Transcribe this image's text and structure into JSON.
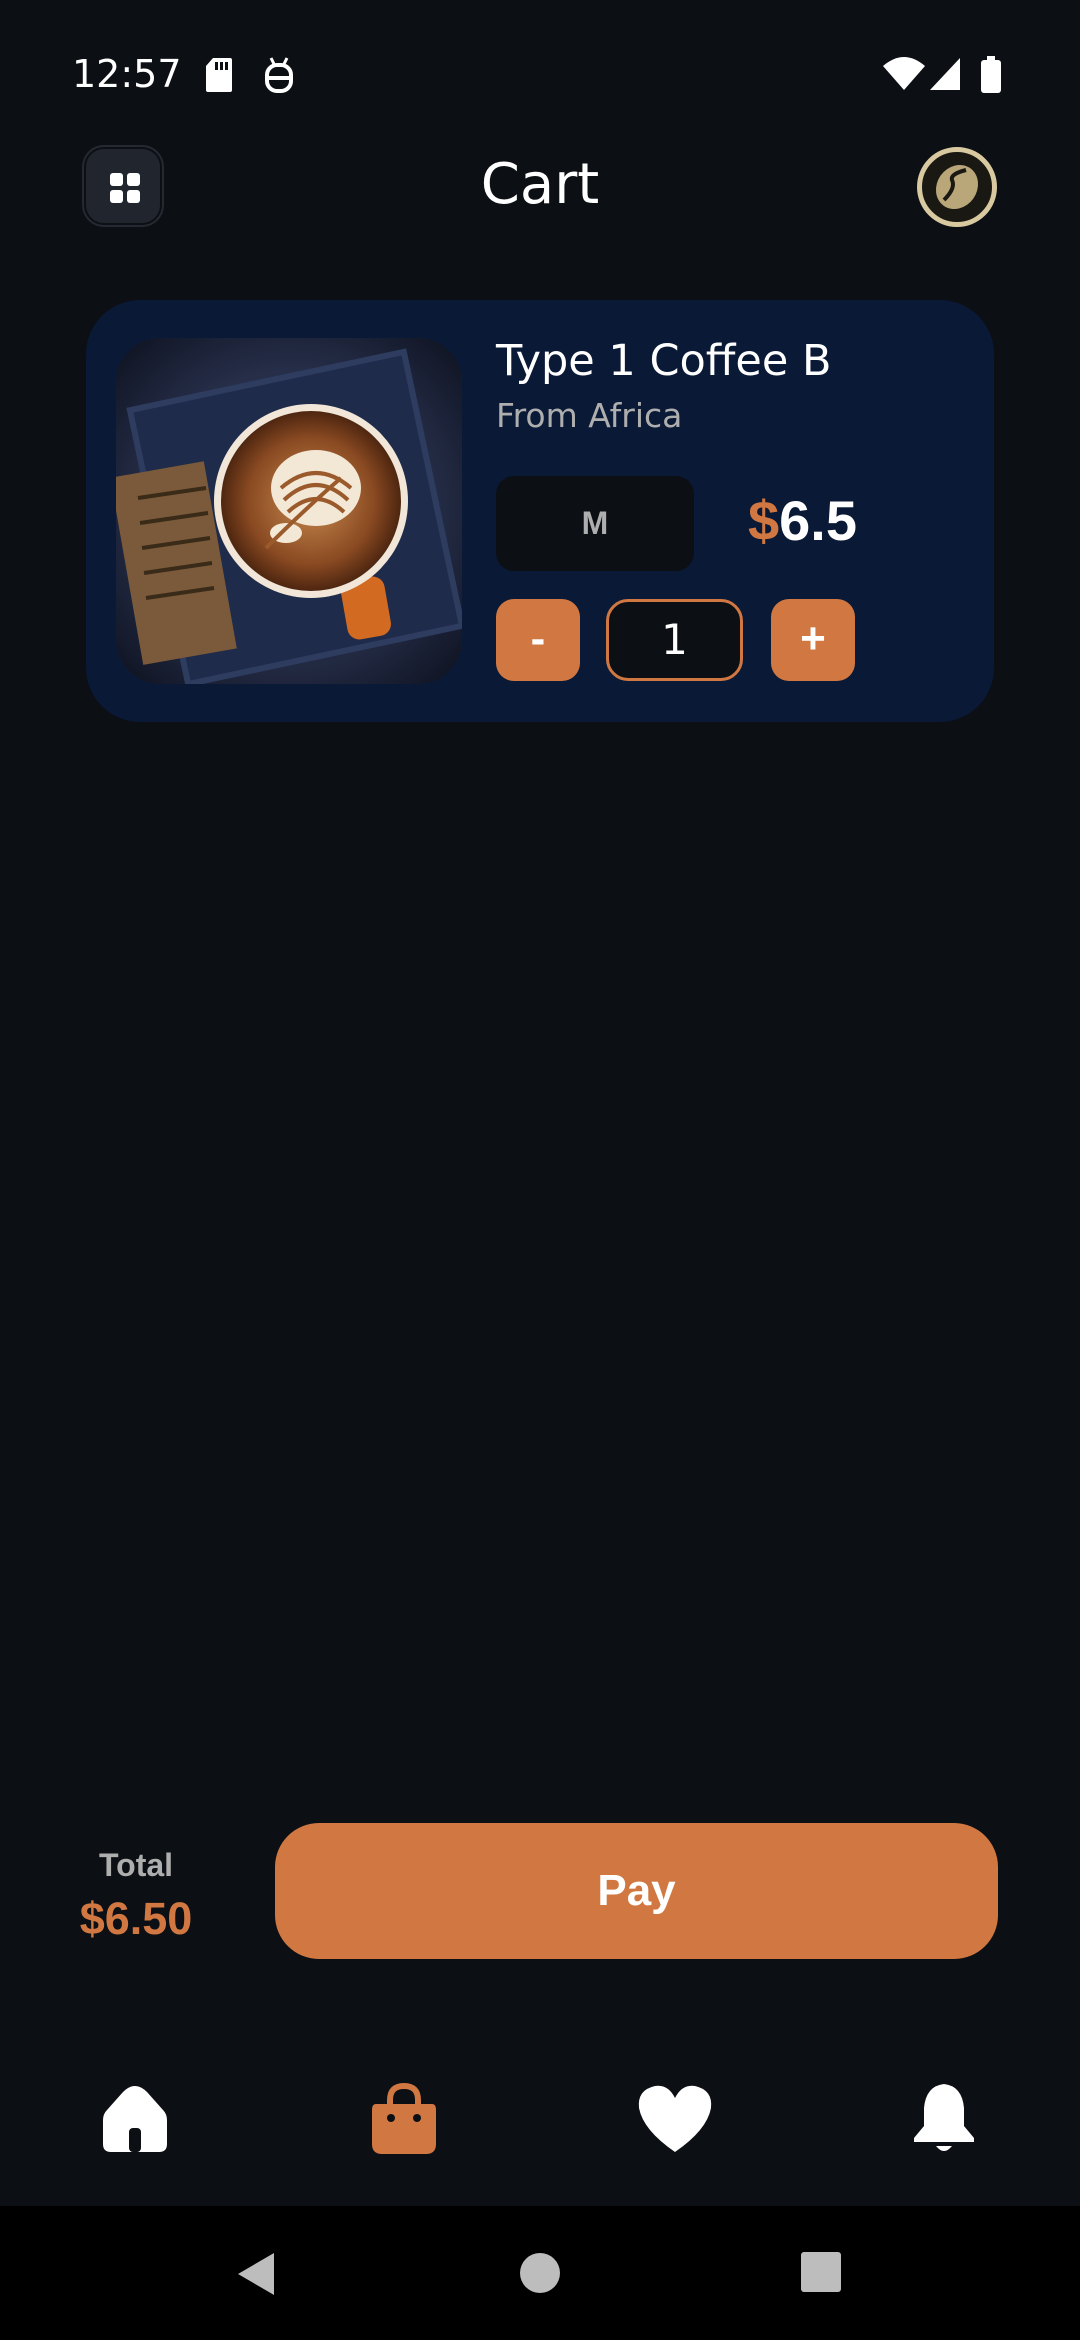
{
  "status_bar": {
    "time": "12:57",
    "left_icons": [
      "sd-card-icon",
      "debug-icon"
    ],
    "right_icons": [
      "wifi-icon",
      "signal-icon",
      "battery-icon"
    ]
  },
  "header": {
    "title": "Cart",
    "menu_icon": "grid-menu-icon",
    "avatar_icon": "coffee-bean-icon"
  },
  "cart": {
    "items": [
      {
        "name": "Type 1 Coffee B",
        "origin": "From Africa",
        "size": "M",
        "currency": "$",
        "price": "6.5",
        "quantity": "1",
        "decrement_label": "-",
        "increment_label": "+",
        "image": "latte-art-coffee-photo"
      }
    ]
  },
  "checkout": {
    "total_label": "Total",
    "total_value": "$6.50",
    "pay_label": "Pay"
  },
  "bottom_nav": {
    "items": [
      {
        "icon": "home-icon",
        "active": false
      },
      {
        "icon": "shopping-bag-icon",
        "active": true
      },
      {
        "icon": "heart-icon",
        "active": false
      },
      {
        "icon": "bell-icon",
        "active": false
      }
    ]
  },
  "system_nav": {
    "buttons": [
      "back-icon",
      "home-circle-icon",
      "recents-icon"
    ]
  },
  "colors": {
    "background": "#0C0F14",
    "accent": "#D17842",
    "card": "#0A1936",
    "secondary_text": "#AEAEAE"
  }
}
